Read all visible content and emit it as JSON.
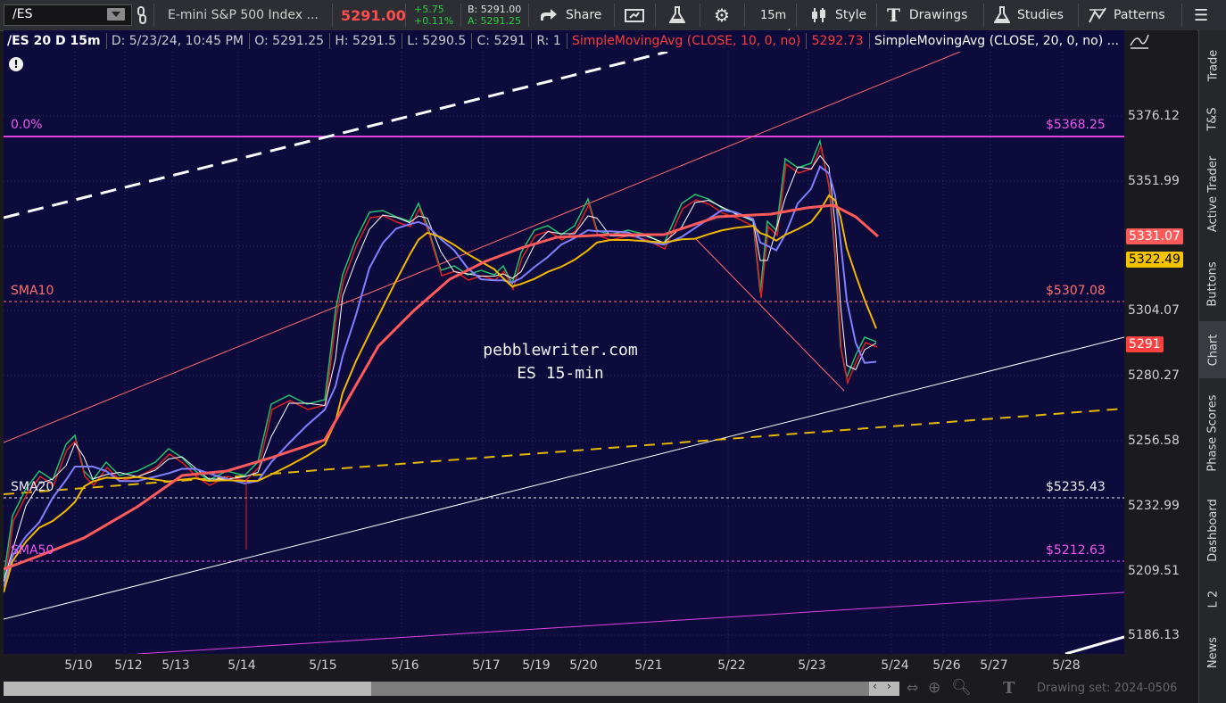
{
  "toolbar": {
    "symbol": "/ES",
    "description": "E-mini S&P 500 Index ...",
    "last_price": "5291.00",
    "change": "+5.75",
    "change_pct": "+0.11%",
    "bid": "B: 5291.00",
    "ask": "A: 5291.25",
    "share_label": "Share",
    "timeframe": "15m",
    "style_label": "Style",
    "drawings_label": "Drawings",
    "studies_label": "Studies",
    "patterns_label": "Patterns",
    "colors": {
      "last_price": "#ff4d4d",
      "change": "#2ecc40",
      "ask": "#2ecc40"
    }
  },
  "studybar": {
    "title": "/ES 20 D 15m",
    "date": "D: 5/23/24, 10:45 PM",
    "open": "O: 5291.25",
    "high": "H: 5291.5",
    "low": "L: 5290.5",
    "close": "C: 5291",
    "range": "R: 1",
    "sma10": "SimpleMovingAvg (CLOSE, 10, 0, no)",
    "sma10_value": "5292.73",
    "sma20": "SimpleMovingAvg (CLOSE, 20, 0, no) ..."
  },
  "price_axis": {
    "ticks": [
      "5376.12",
      "5351.99",
      "5304.07",
      "5280.27",
      "5256.58",
      "5232.99",
      "5209.51",
      "5186.13"
    ],
    "badges": {
      "sma_red": "5331.07",
      "sma_yellow": "5322.49",
      "last": "5291"
    }
  },
  "time_axis": {
    "ticks": [
      "5/10",
      "5/12",
      "5/13",
      "5/14",
      "5/15",
      "5/16",
      "5/17",
      "5/19",
      "5/20",
      "5/21",
      "5/22",
      "5/23",
      "5/24",
      "5/26",
      "5/27",
      "5/28"
    ]
  },
  "chart_labels": {
    "fib_zero": "0.0%",
    "fib_price": "$5368.25",
    "sma10_label": "SMA10",
    "sma10_price": "$5307.08",
    "sma20_label": "SMA20",
    "sma20_price": "$5235.43",
    "sma50_label": "SMA50",
    "sma50_price": "$5212.63",
    "watermark_line1": "pebblewriter.com",
    "watermark_line2": "ES 15-min"
  },
  "side_tabs": [
    "Trade",
    "T&S",
    "Active Trader",
    "Buttons",
    "Chart",
    "Phase Scores",
    "Dashboard",
    "L 2",
    "News"
  ],
  "drawing_set": "Drawing set: 2024-0506"
}
